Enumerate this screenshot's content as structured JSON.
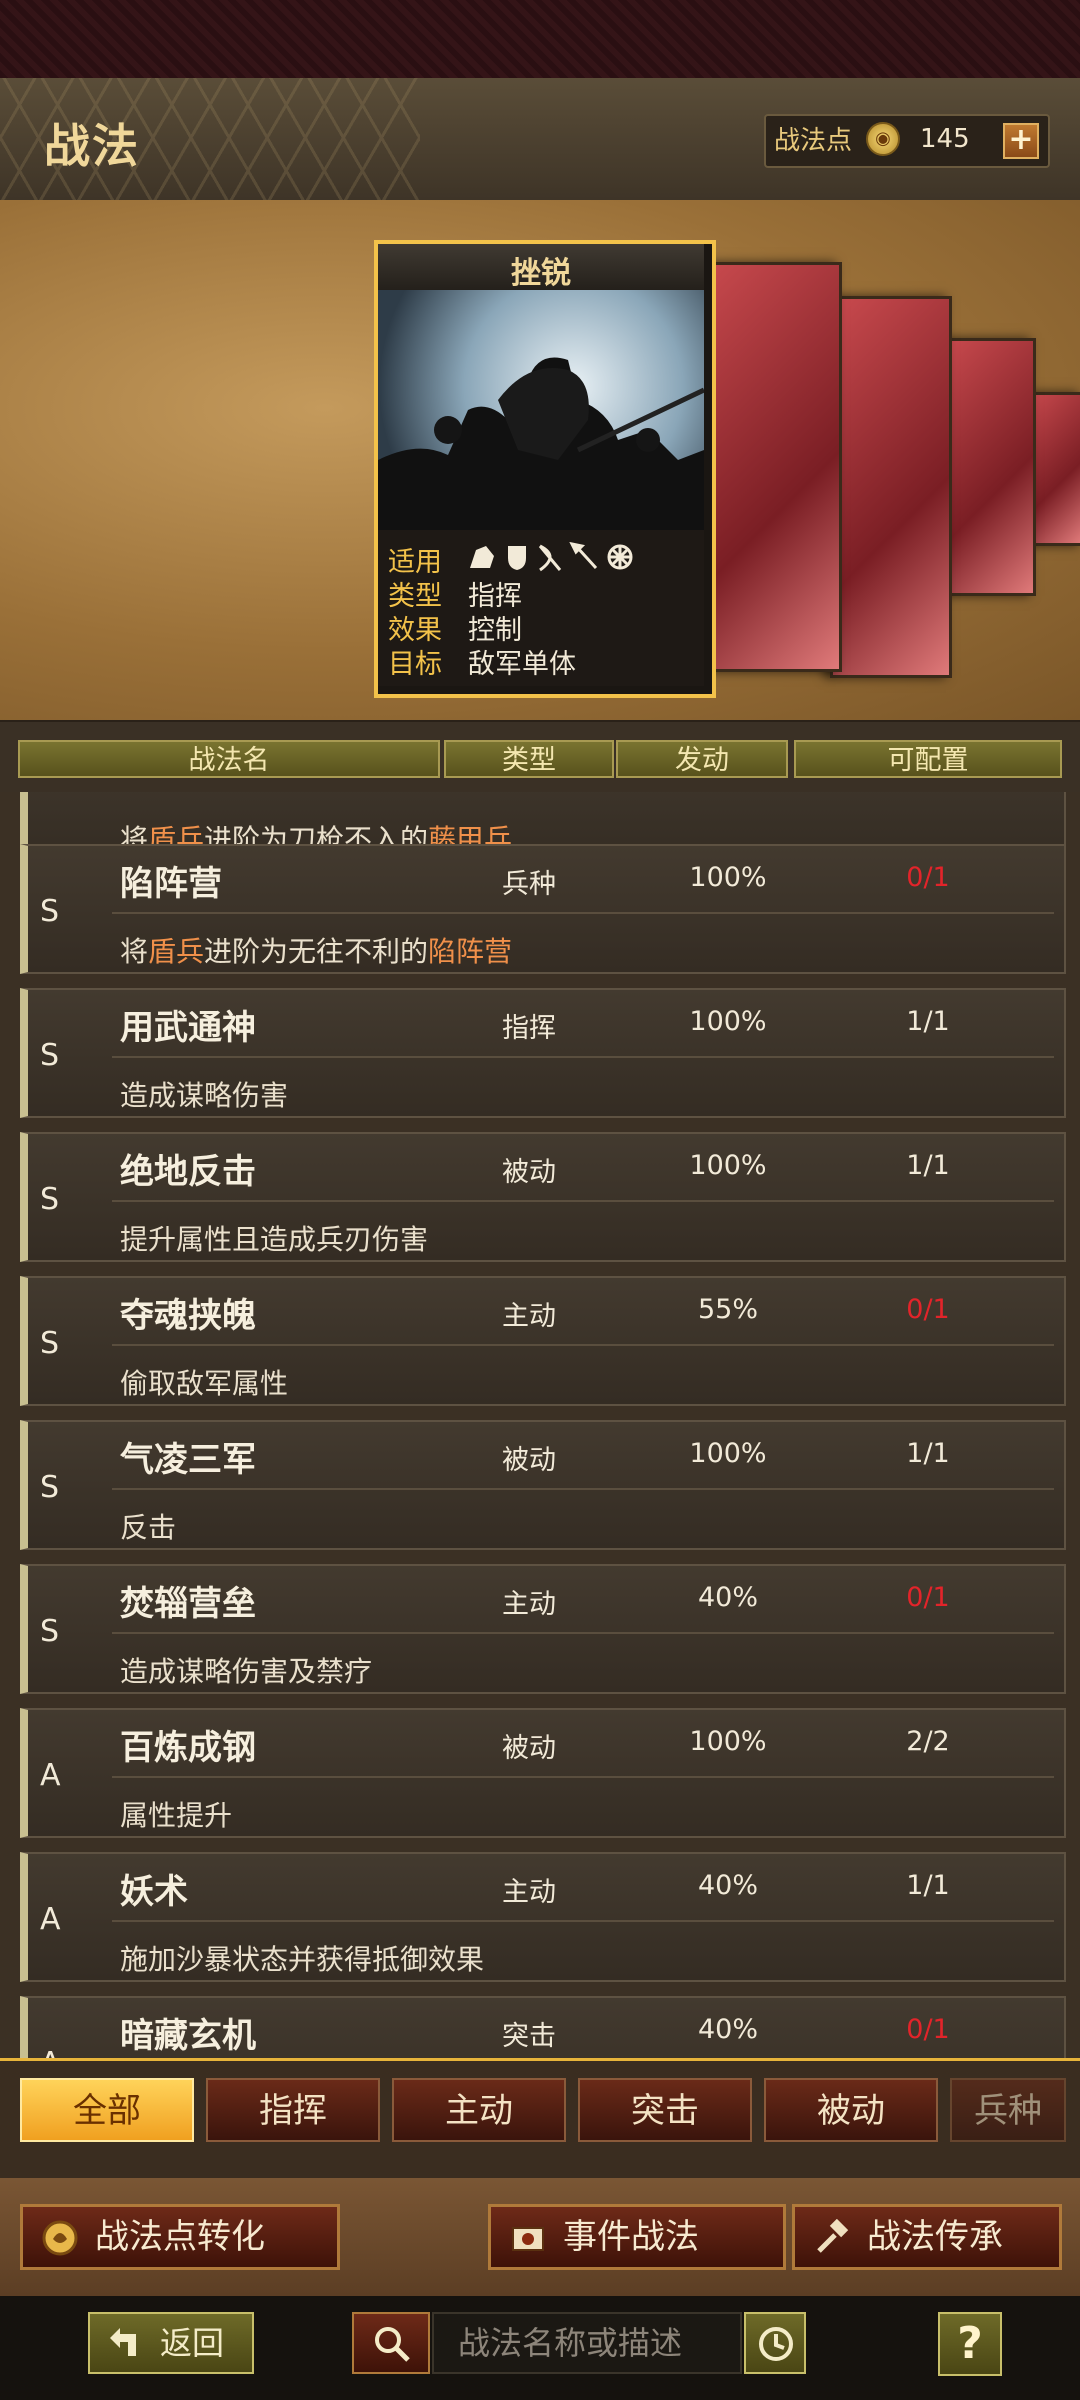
{
  "header": {
    "title": "战法",
    "points_label": "战法点",
    "points_value": "145",
    "plus_label": "+"
  },
  "featured": {
    "name": "挫锐",
    "applies_label": "适用",
    "type_label": "类型",
    "type_value": "指挥",
    "effect_label": "效果",
    "effect_value": "控制",
    "target_label": "目标",
    "target_value": "敌军单体",
    "unit_icons": [
      "cavalry-icon",
      "shield-icon",
      "bow-icon",
      "spear-icon",
      "wheel-icon"
    ]
  },
  "columns": {
    "name": "战法名",
    "type": "类型",
    "rate": "发动",
    "config": "可配置"
  },
  "partial_top": {
    "desc_parts": [
      "将",
      "盾兵",
      "进阶为刀枪不入的",
      "藤甲兵"
    ]
  },
  "skills": [
    {
      "grade": "S",
      "name": "陷阵营",
      "type": "兵种",
      "rate": "100%",
      "config": "0/1",
      "config_red": true,
      "desc_parts": [
        "将",
        "盾兵",
        "进阶为无往不利的",
        "陷阵营"
      ]
    },
    {
      "grade": "S",
      "name": "用武通神",
      "type": "指挥",
      "rate": "100%",
      "config": "1/1",
      "config_red": false,
      "desc": "造成谋略伤害"
    },
    {
      "grade": "S",
      "name": "绝地反击",
      "type": "被动",
      "rate": "100%",
      "config": "1/1",
      "config_red": false,
      "desc": "提升属性且造成兵刃伤害"
    },
    {
      "grade": "S",
      "name": "夺魂挟魄",
      "type": "主动",
      "rate": "55%",
      "config": "0/1",
      "config_red": true,
      "desc": "偷取敌军属性"
    },
    {
      "grade": "S",
      "name": "气凌三军",
      "type": "被动",
      "rate": "100%",
      "config": "1/1",
      "config_red": false,
      "desc": "反击"
    },
    {
      "grade": "S",
      "name": "焚辎营垒",
      "type": "主动",
      "rate": "40%",
      "config": "0/1",
      "config_red": true,
      "desc": "造成谋略伤害及禁疗"
    },
    {
      "grade": "A",
      "name": "百炼成钢",
      "type": "被动",
      "rate": "100%",
      "config": "2/2",
      "config_red": false,
      "desc": "属性提升"
    },
    {
      "grade": "A",
      "name": "妖术",
      "type": "主动",
      "rate": "40%",
      "config": "1/1",
      "config_red": false,
      "desc": "施加沙暴状态并获得抵御效果"
    },
    {
      "grade": "A",
      "name": "暗藏玄机",
      "type": "突击",
      "rate": "40%",
      "config": "0/1",
      "config_red": true,
      "desc": ""
    }
  ],
  "tabs": [
    "全部",
    "指挥",
    "主动",
    "突击",
    "被动",
    "兵种"
  ],
  "active_tab": "全部",
  "buttons": {
    "convert": "战法点转化",
    "event": "事件战法",
    "inherit": "战法传承"
  },
  "footer": {
    "back": "返回",
    "search_placeholder": "战法名称或描述",
    "help": "?"
  },
  "colors": {
    "accent_gold": "#f3c24a",
    "config_full": "#e2242a",
    "highlight": "#f0904a"
  }
}
